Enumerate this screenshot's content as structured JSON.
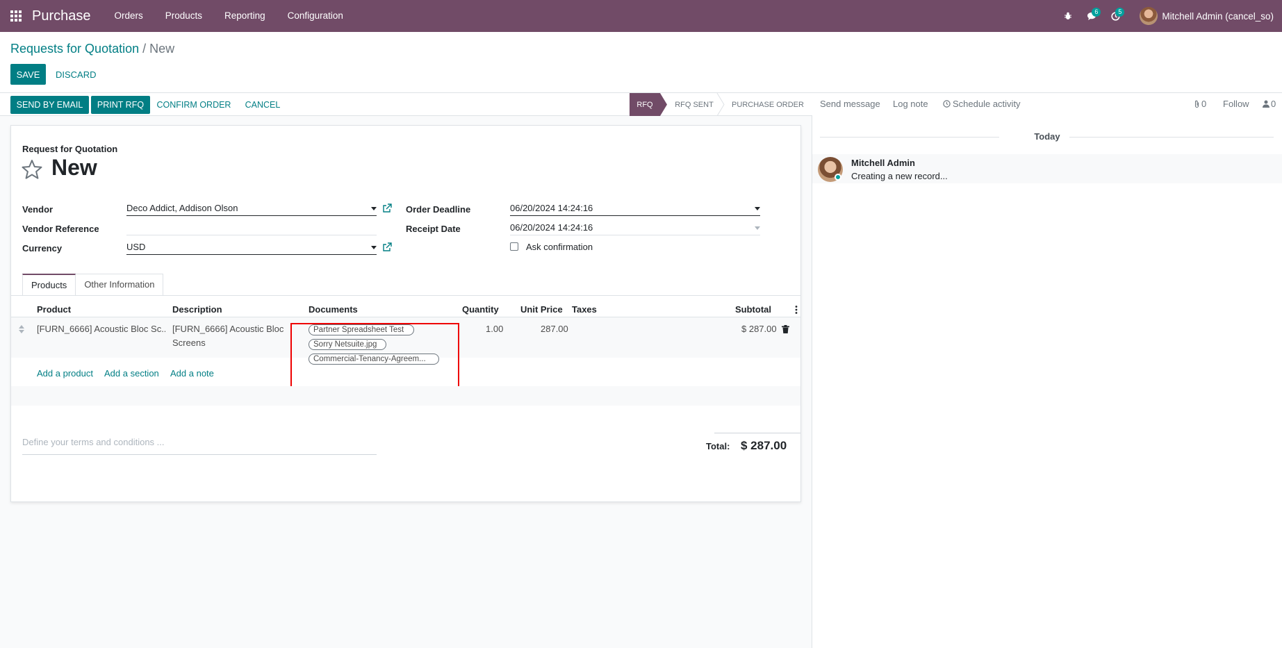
{
  "navbar": {
    "app_name": "Purchase",
    "menu": [
      "Orders",
      "Products",
      "Reporting",
      "Configuration"
    ],
    "messages_count": "6",
    "activities_count": "5",
    "user_name": "Mitchell Admin (cancel_so)"
  },
  "breadcrumb": {
    "parent": "Requests for Quotation",
    "separator": "/",
    "current": "New"
  },
  "buttons": {
    "save": "SAVE",
    "discard": "DISCARD"
  },
  "statusbar": {
    "send_by_email": "SEND BY EMAIL",
    "print_rfq": "PRINT RFQ",
    "confirm_order": "CONFIRM ORDER",
    "cancel": "CANCEL",
    "stages": [
      "RFQ",
      "RFQ SENT",
      "PURCHASE ORDER"
    ],
    "active_stage": "RFQ"
  },
  "form": {
    "type_label": "Request for Quotation",
    "name": "New",
    "vendor_label": "Vendor",
    "vendor": "Deco Addict, Addison Olson",
    "vendor_reference_label": "Vendor Reference",
    "vendor_reference": "",
    "currency_label": "Currency",
    "currency": "USD",
    "order_deadline_label": "Order Deadline",
    "order_deadline": "06/20/2024 14:24:16",
    "receipt_date_label": "Receipt Date",
    "receipt_date": "06/20/2024 14:24:16",
    "ask_confirmation_label": "Ask confirmation",
    "ask_confirmation_checked": false
  },
  "tabs": [
    "Products",
    "Other Information"
  ],
  "table": {
    "headers": [
      "Product",
      "Description",
      "Documents",
      "Quantity",
      "Unit Price",
      "Taxes",
      "Subtotal"
    ],
    "row": {
      "product": "[FURN_6666] Acoustic Bloc Sc...",
      "description_line1": "[FURN_6666] Acoustic Bloc",
      "description_line2": "Screens",
      "documents": [
        "Partner Spreadsheet Test",
        "Sorry Netsuite.jpg",
        "Commercial-Tenancy-Agreem..."
      ],
      "quantity": "1.00",
      "unit_price": "287.00",
      "taxes": "",
      "subtotal": "$ 287.00"
    },
    "add_links": [
      "Add a product",
      "Add a section",
      "Add a note"
    ]
  },
  "terms_placeholder": "Define your terms and conditions ...",
  "total": {
    "label": "Total:",
    "value": "$ 287.00"
  },
  "chatter": {
    "send_message": "Send message",
    "log_note": "Log note",
    "schedule_activity": "Schedule activity",
    "attachments_count": "0",
    "follow": "Follow",
    "followers_count": "0",
    "date_separator": "Today",
    "message_author": "Mitchell Admin",
    "message_body": "Creating a new record..."
  }
}
